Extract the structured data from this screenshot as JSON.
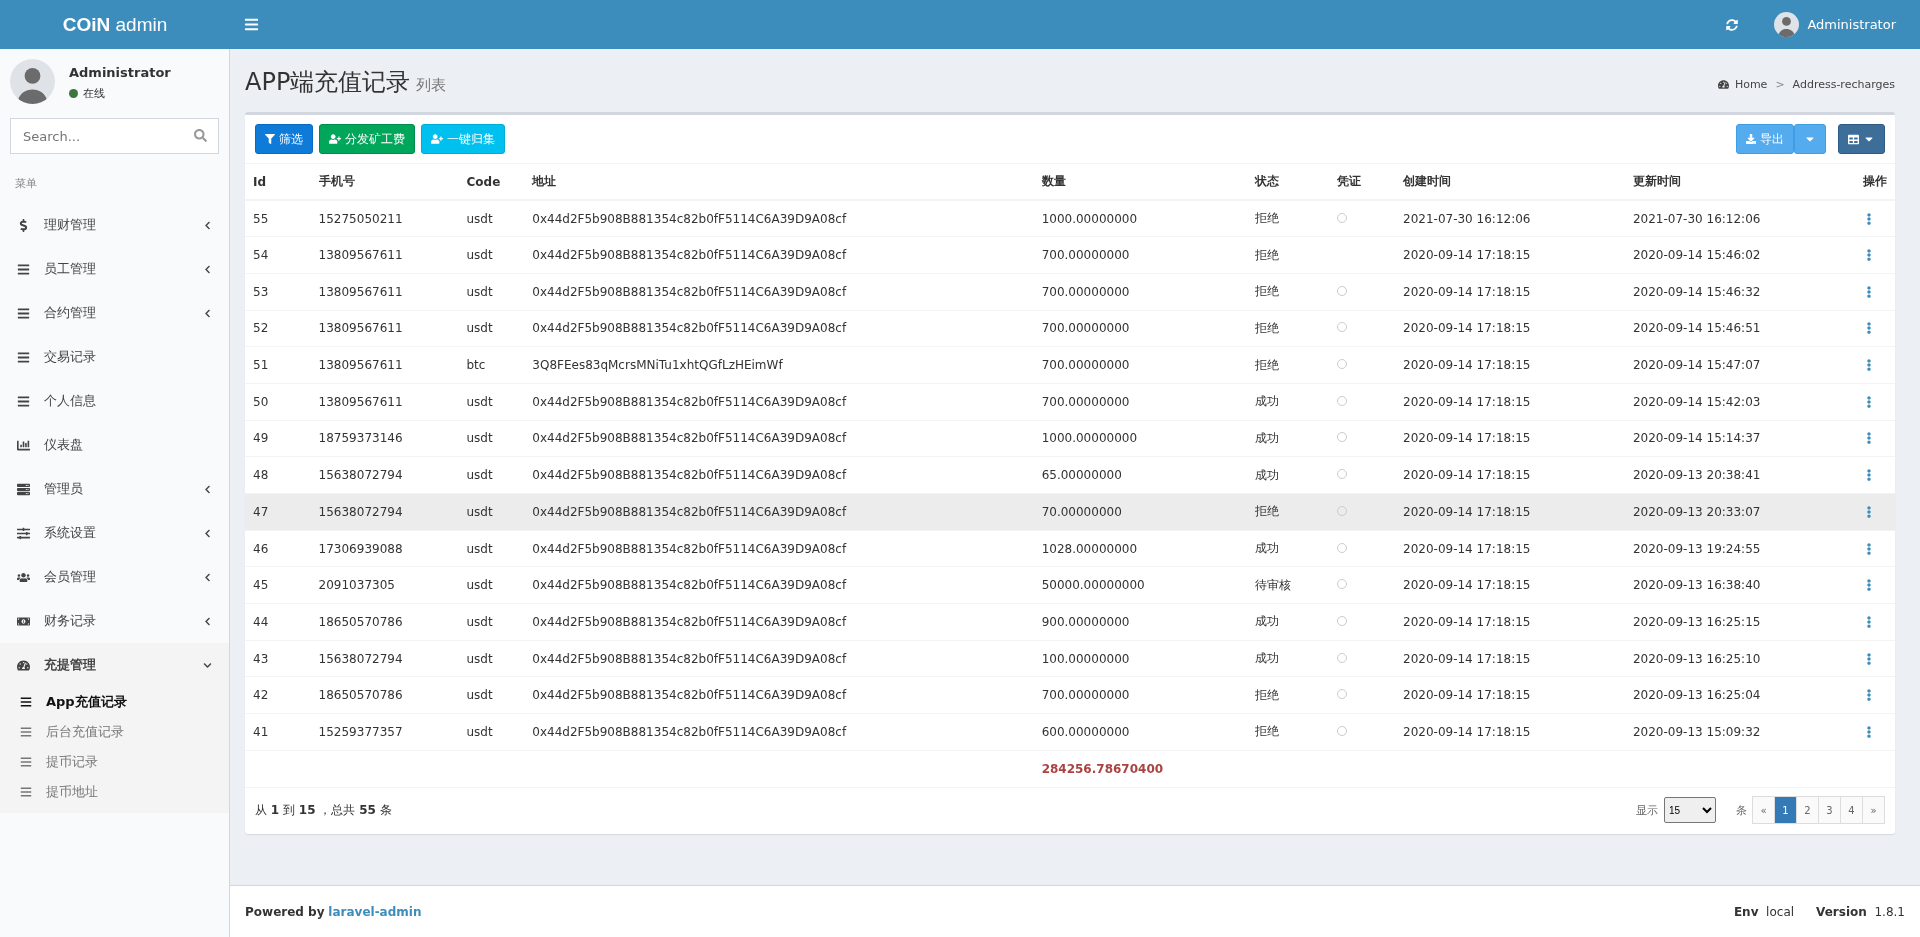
{
  "header": {
    "logo_bold": "COiN",
    "logo_light": "admin",
    "user": "Administrator"
  },
  "sidebar": {
    "user": {
      "name": "Administrator",
      "status": "在线"
    },
    "search": {
      "placeholder": "Search..."
    },
    "section": "菜单",
    "items": [
      {
        "label": "理财管理",
        "has_submenu": true,
        "expanded": false
      },
      {
        "label": "员工管理",
        "has_submenu": true,
        "expanded": false
      },
      {
        "label": "合约管理",
        "has_submenu": true,
        "expanded": false
      },
      {
        "label": "交易记录",
        "has_submenu": false,
        "expanded": false
      },
      {
        "label": "个人信息",
        "has_submenu": false,
        "expanded": false
      },
      {
        "label": "仪表盘",
        "has_submenu": false,
        "expanded": false
      },
      {
        "label": "管理员",
        "has_submenu": true,
        "expanded": false
      },
      {
        "label": "系统设置",
        "has_submenu": true,
        "expanded": false
      },
      {
        "label": "会员管理",
        "has_submenu": true,
        "expanded": false
      },
      {
        "label": "财务记录",
        "has_submenu": true,
        "expanded": false
      },
      {
        "label": "充提管理",
        "has_submenu": true,
        "expanded": true,
        "children": [
          {
            "label": "App充值记录",
            "selected": true
          },
          {
            "label": "后台充值记录",
            "selected": false
          },
          {
            "label": "提币记录",
            "selected": false
          },
          {
            "label": "提币地址",
            "selected": false
          }
        ]
      }
    ]
  },
  "page": {
    "title": "APP端充值记录",
    "subtitle": "列表",
    "breadcrumb": [
      "Home",
      "Address-recharges"
    ],
    "separator": ">"
  },
  "toolbar": {
    "buttons": [
      "筛选",
      "分发矿工费",
      "一键归集"
    ],
    "export": "导出"
  },
  "table": {
    "columns": [
      "Id",
      "手机号",
      "Code",
      "地址",
      "数量",
      "状态",
      "凭证",
      "创建时间",
      "更新时间",
      "操作"
    ],
    "rows": [
      {
        "id": "55",
        "phone": "15275050211",
        "code": "usdt",
        "address": "0x44d2F5b908B881354c82b0fF5114C6A39D9A08cf",
        "amount": "1000.00000000",
        "status": "拒绝",
        "voucher": true,
        "created": "2021-07-30 16:12:06",
        "updated": "2021-07-30 16:12:06",
        "highlighted": false
      },
      {
        "id": "54",
        "phone": "13809567611",
        "code": "usdt",
        "address": "0x44d2F5b908B881354c82b0fF5114C6A39D9A08cf",
        "amount": "700.00000000",
        "status": "拒绝",
        "voucher": false,
        "created": "2020-09-14 17:18:15",
        "updated": "2020-09-14 15:46:02",
        "highlighted": false
      },
      {
        "id": "53",
        "phone": "13809567611",
        "code": "usdt",
        "address": "0x44d2F5b908B881354c82b0fF5114C6A39D9A08cf",
        "amount": "700.00000000",
        "status": "拒绝",
        "voucher": true,
        "created": "2020-09-14 17:18:15",
        "updated": "2020-09-14 15:46:32",
        "highlighted": false
      },
      {
        "id": "52",
        "phone": "13809567611",
        "code": "usdt",
        "address": "0x44d2F5b908B881354c82b0fF5114C6A39D9A08cf",
        "amount": "700.00000000",
        "status": "拒绝",
        "voucher": true,
        "created": "2020-09-14 17:18:15",
        "updated": "2020-09-14 15:46:51",
        "highlighted": false
      },
      {
        "id": "51",
        "phone": "13809567611",
        "code": "btc",
        "address": "3Q8FEes83qMcrsMNiTu1xhtQGfLzHEimWf",
        "amount": "700.00000000",
        "status": "拒绝",
        "voucher": true,
        "created": "2020-09-14 17:18:15",
        "updated": "2020-09-14 15:47:07",
        "highlighted": false
      },
      {
        "id": "50",
        "phone": "13809567611",
        "code": "usdt",
        "address": "0x44d2F5b908B881354c82b0fF5114C6A39D9A08cf",
        "amount": "700.00000000",
        "status": "成功",
        "voucher": true,
        "created": "2020-09-14 17:18:15",
        "updated": "2020-09-14 15:42:03",
        "highlighted": false
      },
      {
        "id": "49",
        "phone": "18759373146",
        "code": "usdt",
        "address": "0x44d2F5b908B881354c82b0fF5114C6A39D9A08cf",
        "amount": "1000.00000000",
        "status": "成功",
        "voucher": true,
        "created": "2020-09-14 17:18:15",
        "updated": "2020-09-14 15:14:37",
        "highlighted": false
      },
      {
        "id": "48",
        "phone": "15638072794",
        "code": "usdt",
        "address": "0x44d2F5b908B881354c82b0fF5114C6A39D9A08cf",
        "amount": "65.00000000",
        "status": "成功",
        "voucher": true,
        "created": "2020-09-14 17:18:15",
        "updated": "2020-09-13 20:38:41",
        "highlighted": false
      },
      {
        "id": "47",
        "phone": "15638072794",
        "code": "usdt",
        "address": "0x44d2F5b908B881354c82b0fF5114C6A39D9A08cf",
        "amount": "70.00000000",
        "status": "拒绝",
        "voucher": true,
        "created": "2020-09-14 17:18:15",
        "updated": "2020-09-13 20:33:07",
        "highlighted": true
      },
      {
        "id": "46",
        "phone": "17306939088",
        "code": "usdt",
        "address": "0x44d2F5b908B881354c82b0fF5114C6A39D9A08cf",
        "amount": "1028.00000000",
        "status": "成功",
        "voucher": true,
        "created": "2020-09-14 17:18:15",
        "updated": "2020-09-13 19:24:55",
        "highlighted": false
      },
      {
        "id": "45",
        "phone": "2091037305",
        "code": "usdt",
        "address": "0x44d2F5b908B881354c82b0fF5114C6A39D9A08cf",
        "amount": "50000.00000000",
        "status": "待审核",
        "voucher": true,
        "created": "2020-09-14 17:18:15",
        "updated": "2020-09-13 16:38:40",
        "highlighted": false
      },
      {
        "id": "44",
        "phone": "18650570786",
        "code": "usdt",
        "address": "0x44d2F5b908B881354c82b0fF5114C6A39D9A08cf",
        "amount": "900.00000000",
        "status": "成功",
        "voucher": true,
        "created": "2020-09-14 17:18:15",
        "updated": "2020-09-13 16:25:15",
        "highlighted": false
      },
      {
        "id": "43",
        "phone": "15638072794",
        "code": "usdt",
        "address": "0x44d2F5b908B881354c82b0fF5114C6A39D9A08cf",
        "amount": "100.00000000",
        "status": "成功",
        "voucher": true,
        "created": "2020-09-14 17:18:15",
        "updated": "2020-09-13 16:25:10",
        "highlighted": false
      },
      {
        "id": "42",
        "phone": "18650570786",
        "code": "usdt",
        "address": "0x44d2F5b908B881354c82b0fF5114C6A39D9A08cf",
        "amount": "700.00000000",
        "status": "拒绝",
        "voucher": true,
        "created": "2020-09-14 17:18:15",
        "updated": "2020-09-13 16:25:04",
        "highlighted": false
      },
      {
        "id": "41",
        "phone": "15259377357",
        "code": "usdt",
        "address": "0x44d2F5b908B881354c82b0fF5114C6A39D9A08cf",
        "amount": "600.00000000",
        "status": "拒绝",
        "voucher": true,
        "created": "2020-09-14 17:18:15",
        "updated": "2020-09-13 15:09:32",
        "highlighted": false
      }
    ],
    "total": "284256.78670400"
  },
  "footer_info": "从 **1** 到 **15** ，总共 **55** 条",
  "pagination": {
    "show_label": "显示",
    "per_page": "15",
    "unit": "条",
    "prev": "«",
    "next": "»",
    "pages": [
      {
        "label": "1",
        "selected": true
      },
      {
        "label": "2",
        "selected": false
      },
      {
        "label": "3",
        "selected": false
      },
      {
        "label": "4",
        "selected": false
      }
    ]
  },
  "footer": {
    "powered": "Powered by",
    "link": "laravel-admin",
    "env_label": "Env",
    "env": "local",
    "version_label": "Version",
    "version": "1.8.1"
  }
}
